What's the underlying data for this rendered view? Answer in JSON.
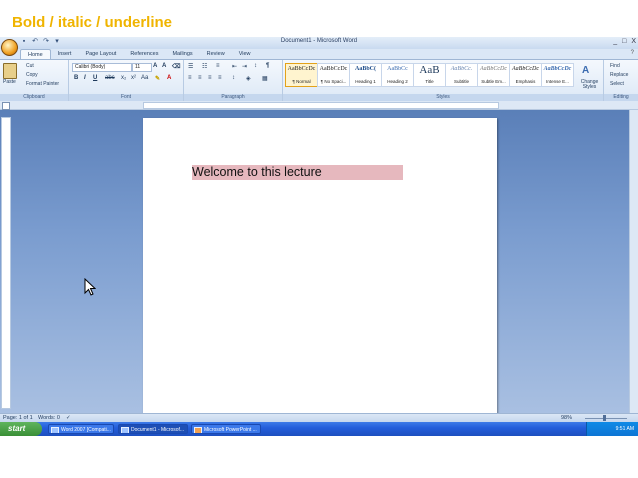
{
  "slide": {
    "title": "Bold / italic / underline"
  },
  "window": {
    "title": "Document1 - Microsoft Word",
    "controls": [
      "_",
      "□",
      "X"
    ]
  },
  "tabs": [
    {
      "label": "Home",
      "active": true
    },
    {
      "label": "Insert",
      "active": false
    },
    {
      "label": "Page Layout",
      "active": false
    },
    {
      "label": "References",
      "active": false
    },
    {
      "label": "Mailings",
      "active": false
    },
    {
      "label": "Review",
      "active": false
    },
    {
      "label": "View",
      "active": false
    }
  ],
  "ribbon": {
    "clipboard": {
      "paste": "Paste",
      "cut": "Cut",
      "copy": "Copy",
      "format_painter": "Format Painter",
      "label": "Clipboard"
    },
    "font": {
      "name": "Calibri (Body)",
      "size": "11",
      "label": "Font"
    },
    "paragraph": {
      "label": "Paragraph"
    },
    "styles": {
      "label": "Styles",
      "items": [
        {
          "sample": "AaBbCcDc",
          "name": "¶ Normal"
        },
        {
          "sample": "AaBbCcDc",
          "name": "¶ No Spaci..."
        },
        {
          "sample": "AaBbC(",
          "name": "Heading 1"
        },
        {
          "sample": "AaBbCc",
          "name": "Heading 2"
        },
        {
          "sample": "AaB",
          "name": "Title"
        },
        {
          "sample": "AaBbCc.",
          "name": "Subtitle"
        },
        {
          "sample": "AaBbCcDc",
          "name": "Subtle Em..."
        },
        {
          "sample": "AaBbCcDc",
          "name": "Emphasis"
        },
        {
          "sample": "AaBbCcDc",
          "name": "Intense E..."
        }
      ],
      "change_styles": "Change Styles"
    },
    "editing": {
      "find": "Find",
      "replace": "Replace",
      "select": "Select",
      "label": "Editing"
    }
  },
  "document": {
    "text": "Welcome to this lecture"
  },
  "status": {
    "page": "Page: 1 of 1",
    "words": "Words: 0",
    "zoom": "98%"
  },
  "taskbar": {
    "start": "start",
    "tasks": [
      {
        "label": "Word 2007 [Compati..."
      },
      {
        "label": "Document1 - Microsof..."
      },
      {
        "label": "Microsoft PowerPoint ..."
      }
    ],
    "clock": "9:51 AM"
  }
}
